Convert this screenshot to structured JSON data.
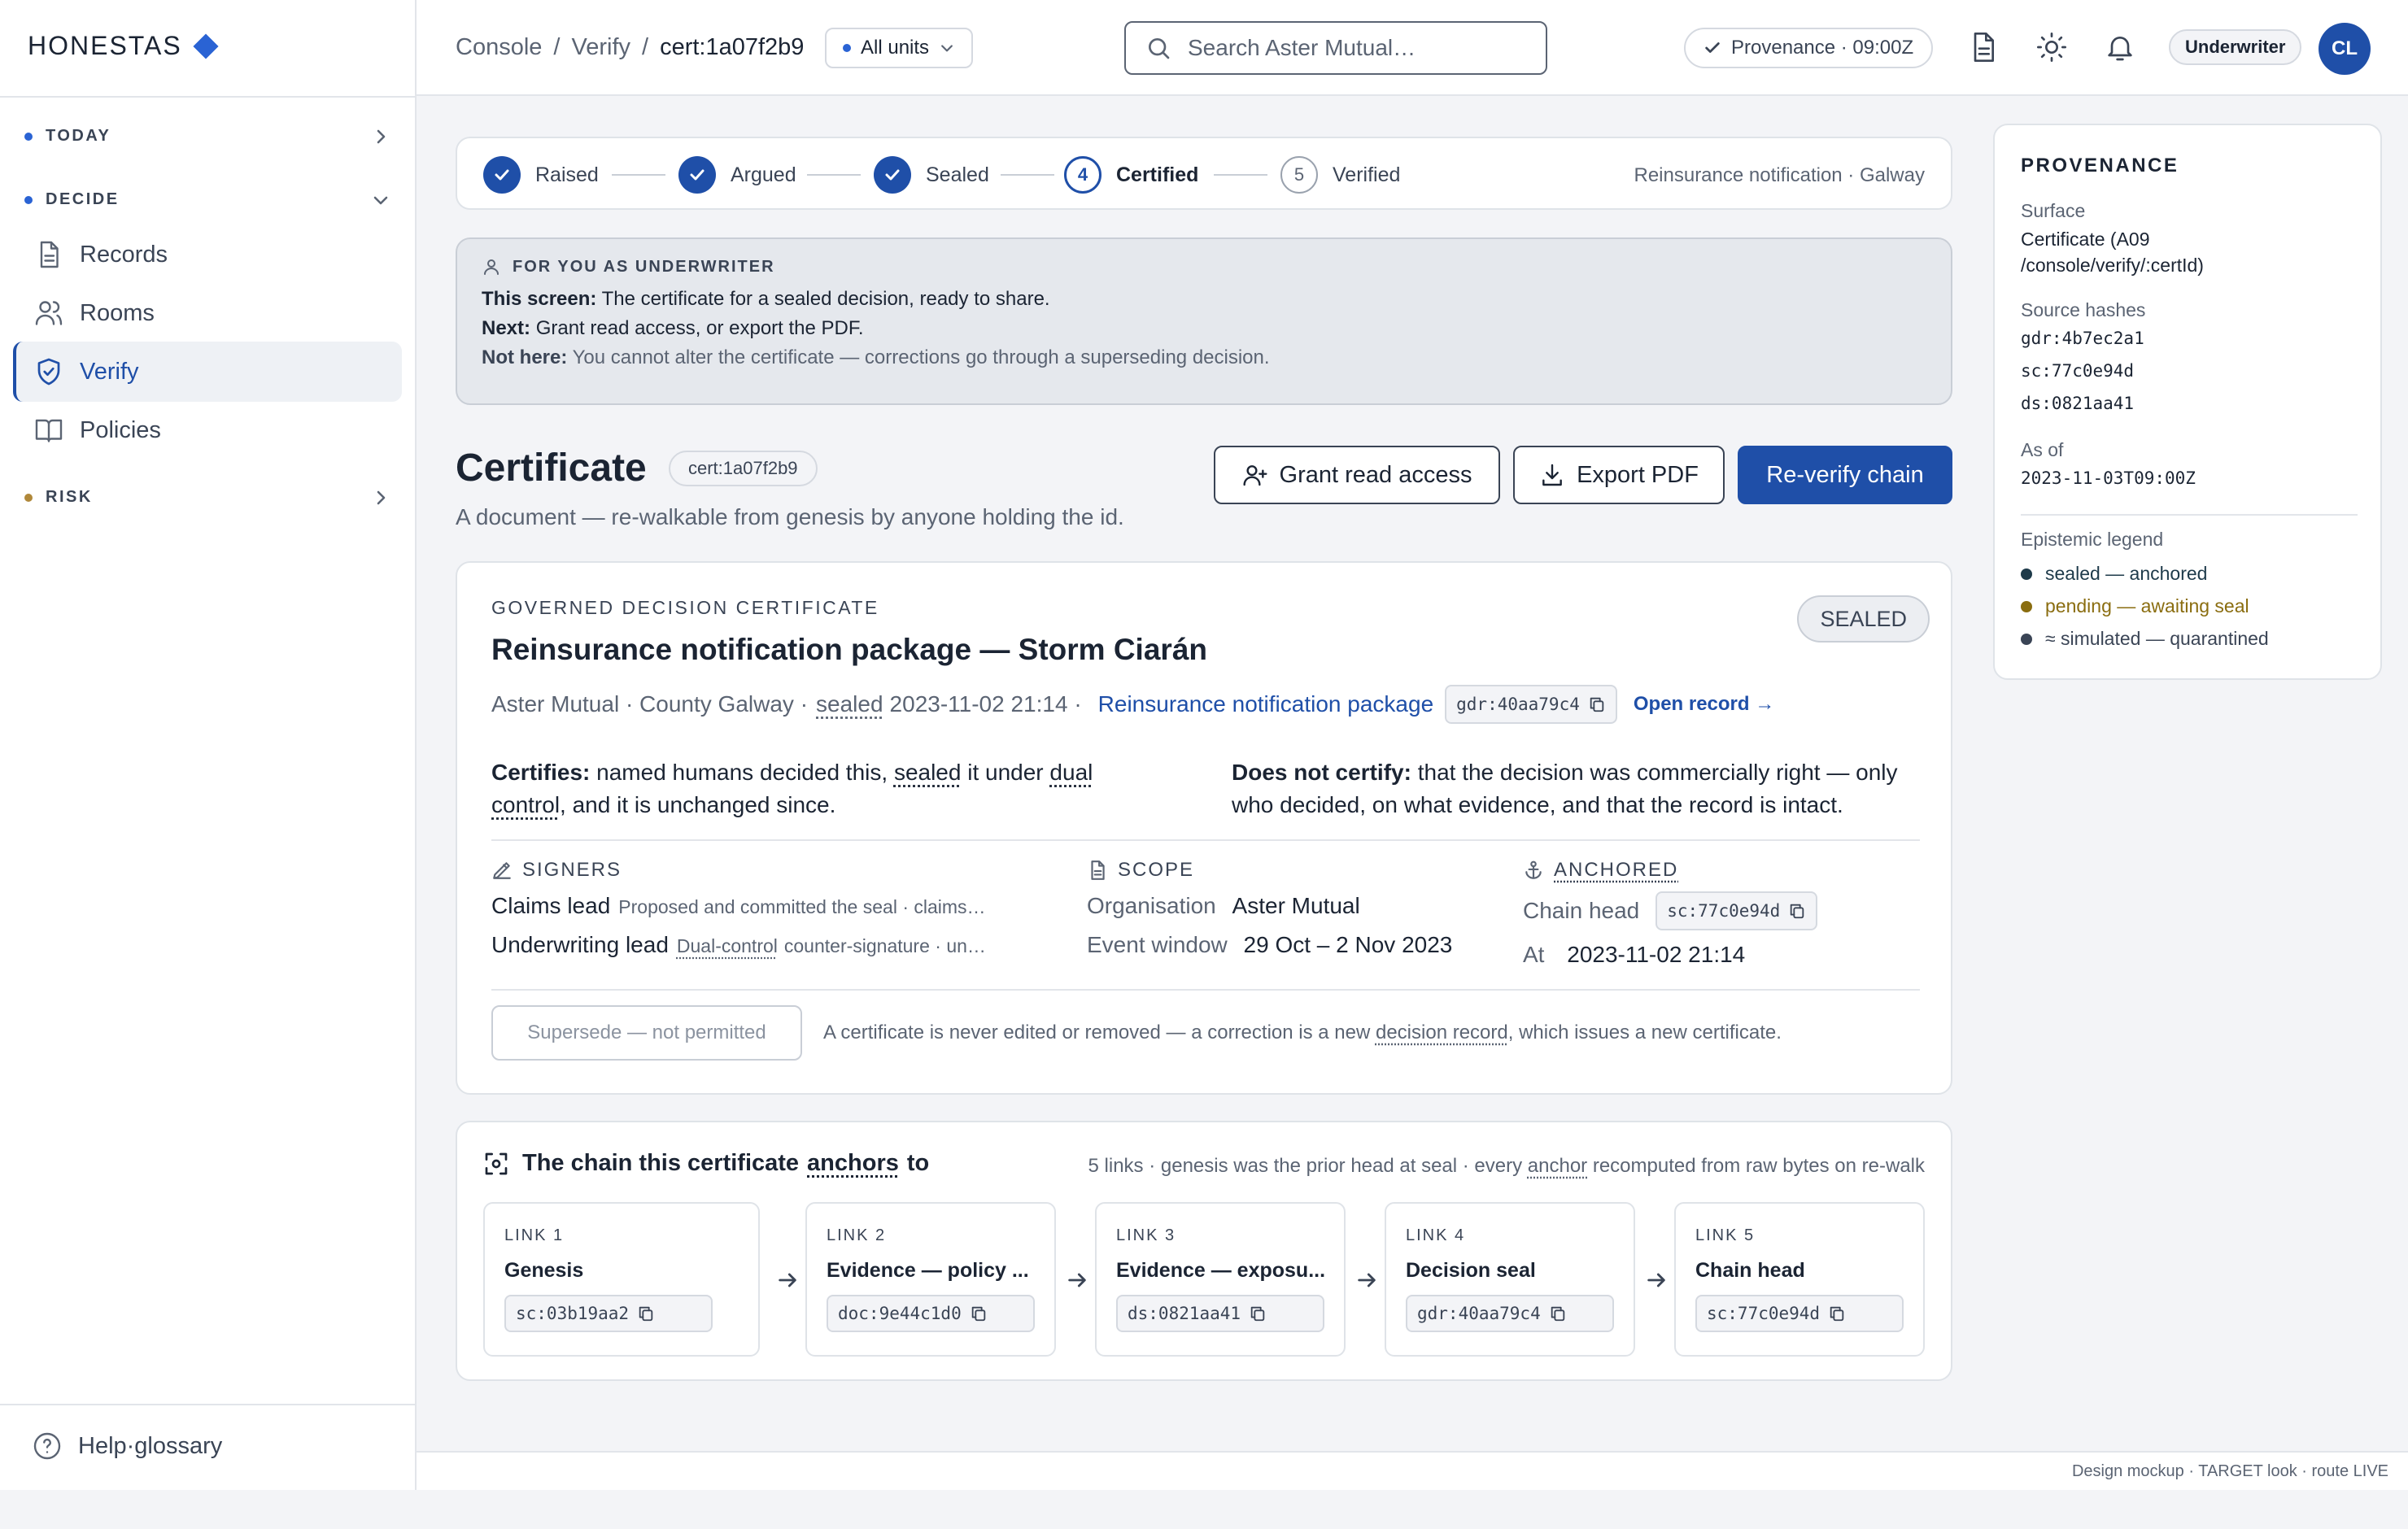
{
  "brand": "HONESTAS",
  "sidebar": {
    "sections": [
      {
        "label": "TODAY",
        "color": "#2a63d4"
      },
      {
        "label": "DECIDE",
        "color": "#2a63d4"
      },
      {
        "label": "RISK",
        "color": "#b0883a"
      }
    ],
    "items": [
      {
        "label": "Records",
        "icon": "document-icon"
      },
      {
        "label": "Rooms",
        "icon": "people-icon"
      },
      {
        "label": "Verify",
        "icon": "shield-check-icon",
        "active": true
      },
      {
        "label": "Policies",
        "icon": "book-icon"
      }
    ],
    "help": "Help·glossary"
  },
  "header": {
    "breadcrumb": [
      "Console",
      "Verify",
      "cert:1a07f2b9"
    ],
    "separator": "/",
    "units": "All units",
    "search_placeholder": "Search Aster Mutual…",
    "provenance_pill": "Provenance · 09:00Z",
    "role": "Underwriter",
    "avatar": "CL"
  },
  "stepper": {
    "steps": [
      {
        "n": "1",
        "label": "Raised",
        "state": "done"
      },
      {
        "n": "2",
        "label": "Argued",
        "state": "done"
      },
      {
        "n": "3",
        "label": "Sealed",
        "state": "done"
      },
      {
        "n": "4",
        "label": "Certified",
        "state": "current"
      },
      {
        "n": "5",
        "label": "Verified",
        "state": "todo"
      }
    ],
    "context": "Reinsurance notification · Galway"
  },
  "for_you": {
    "heading": "FOR YOU AS UNDERWRITER",
    "lines": [
      {
        "k": "This screen:",
        "v": "The certificate for a sealed decision, ready to share."
      },
      {
        "k": "Next:",
        "v": "Grant read access, or export the PDF."
      },
      {
        "k": "Not here:",
        "v": "You cannot alter the certificate — corrections go through a superseding decision."
      }
    ]
  },
  "page": {
    "title": "Certificate",
    "chip": "cert:1a07f2b9",
    "subtitle": "A document — re-walkable from genesis by anyone holding the id.",
    "buttons": {
      "grant": "Grant read access",
      "export": "Export PDF",
      "reverify": "Re-verify chain"
    }
  },
  "certificate": {
    "kicker": "GOVERNED DECISION CERTIFICATE",
    "title": "Reinsurance notification package — Storm Ciarán",
    "status": "SEALED",
    "meta_org": "Aster Mutual · County Galway ·",
    "meta_sealed_word": "sealed",
    "meta_sealed_at": "2023-11-02 21:14 ·",
    "meta_link": "Reinsurance notification package",
    "meta_hash": "gdr:40aa79c4",
    "open_record": "Open record →",
    "certifies_label": "Certifies:",
    "certifies_a": "named humans decided this,",
    "certifies_sealed": "sealed",
    "certifies_b": "it under",
    "certifies_dual": "dual control",
    "certifies_c": ", and it is unchanged since.",
    "not_certify_label": "Does not certify:",
    "not_certify_text": "that the decision was commercially right — only who decided, on what evidence, and that the record is intact.",
    "signers": {
      "heading": "SIGNERS",
      "rows": [
        {
          "role": "Claims lead",
          "note": "Proposed and committed the seal · claims…"
        },
        {
          "role": "Underwriting lead",
          "note_u": "Dual-control",
          "note": "counter-signature · un…"
        }
      ]
    },
    "scope": {
      "heading": "SCOPE",
      "organisation_k": "Organisation",
      "organisation_v": "Aster Mutual",
      "window_k": "Event window",
      "window_v": "29 Oct – 2 Nov 2023"
    },
    "anchored": {
      "heading": "ANCHORED",
      "chain_head_k": "Chain head",
      "chain_head_v": "sc:77c0e94d",
      "at_k": "At",
      "at_v": "2023-11-02 21:14"
    },
    "supersede_button": "Supersede — not permitted",
    "supersede_note_a": "A certificate is never edited or removed — a correction is a new",
    "supersede_note_link": "decision record",
    "supersede_note_b": ", which issues a new certificate."
  },
  "chain": {
    "title_a": "The chain this certificate",
    "title_u": "anchors",
    "title_b": "to",
    "note_a": "5 links · genesis was the prior head at seal · every",
    "note_u": "anchor",
    "note_b": "recomputed from raw bytes on re-walk",
    "links": [
      {
        "label": "LINK 1",
        "title": "Genesis",
        "hash": "sc:03b19aa2"
      },
      {
        "label": "LINK 2",
        "title": "Evidence — policy ...",
        "hash": "doc:9e44c1d0"
      },
      {
        "label": "LINK 3",
        "title": "Evidence — exposu...",
        "hash": "ds:0821aa41"
      },
      {
        "label": "LINK 4",
        "title": "Decision seal",
        "hash": "gdr:40aa79c4"
      },
      {
        "label": "LINK 5",
        "title": "Chain head",
        "hash": "sc:77c0e94d"
      }
    ]
  },
  "provenance": {
    "heading": "PROVENANCE",
    "surface_label": "Surface",
    "surface_value_1": "Certificate (A09",
    "surface_value_2": "/console/verify/:certId)",
    "hashes_label": "Source hashes",
    "hashes": [
      "gdr:4b7ec2a1",
      "sc:77c0e94d",
      "ds:0821aa41"
    ],
    "asof_label": "As of",
    "asof_value": "2023-11-03T09:00Z",
    "legend_label": "Epistemic legend",
    "legend": [
      {
        "text": "sealed — anchored",
        "color": "#1e3a4a",
        "text_color": "#1e3a4a"
      },
      {
        "text": "pending — awaiting seal",
        "color": "#8a6d10",
        "text_color": "#8a6d10"
      },
      {
        "text": "≈ simulated — quarantined",
        "color": "#3a4455",
        "text_color": "#3a4455"
      }
    ]
  },
  "footer": "Design mockup · TARGET look · route LIVE",
  "colors": {
    "accent": "#1f4fa8",
    "brand": "#2a63d4"
  }
}
